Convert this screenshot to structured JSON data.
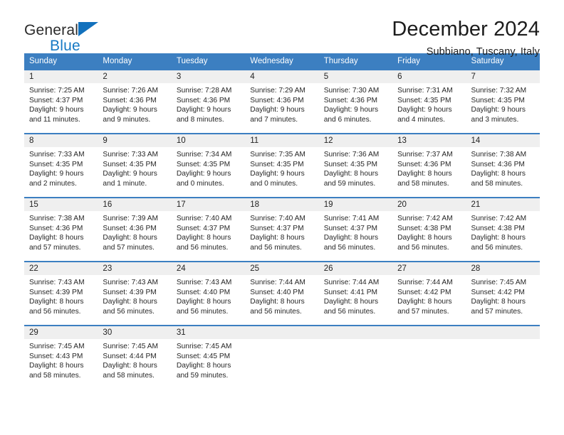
{
  "brand": {
    "line1": "General",
    "line2": "Blue",
    "triangle_color": "#1271bd",
    "line2_color": "#1679c4"
  },
  "header": {
    "title": "December 2024",
    "subtitle": "Subbiano, Tuscany, Italy"
  },
  "theme": {
    "header_blue": "#3c7fc1",
    "datenum_gray": "#efefef",
    "text": "#262626"
  },
  "weekdays": [
    "Sunday",
    "Monday",
    "Tuesday",
    "Wednesday",
    "Thursday",
    "Friday",
    "Saturday"
  ],
  "weeks": [
    [
      {
        "day": "1",
        "sunrise": "Sunrise: 7:25 AM",
        "sunset": "Sunset: 4:37 PM",
        "daylight1": "Daylight: 9 hours",
        "daylight2": "and 11 minutes."
      },
      {
        "day": "2",
        "sunrise": "Sunrise: 7:26 AM",
        "sunset": "Sunset: 4:36 PM",
        "daylight1": "Daylight: 9 hours",
        "daylight2": "and 9 minutes."
      },
      {
        "day": "3",
        "sunrise": "Sunrise: 7:28 AM",
        "sunset": "Sunset: 4:36 PM",
        "daylight1": "Daylight: 9 hours",
        "daylight2": "and 8 minutes."
      },
      {
        "day": "4",
        "sunrise": "Sunrise: 7:29 AM",
        "sunset": "Sunset: 4:36 PM",
        "daylight1": "Daylight: 9 hours",
        "daylight2": "and 7 minutes."
      },
      {
        "day": "5",
        "sunrise": "Sunrise: 7:30 AM",
        "sunset": "Sunset: 4:36 PM",
        "daylight1": "Daylight: 9 hours",
        "daylight2": "and 6 minutes."
      },
      {
        "day": "6",
        "sunrise": "Sunrise: 7:31 AM",
        "sunset": "Sunset: 4:35 PM",
        "daylight1": "Daylight: 9 hours",
        "daylight2": "and 4 minutes."
      },
      {
        "day": "7",
        "sunrise": "Sunrise: 7:32 AM",
        "sunset": "Sunset: 4:35 PM",
        "daylight1": "Daylight: 9 hours",
        "daylight2": "and 3 minutes."
      }
    ],
    [
      {
        "day": "8",
        "sunrise": "Sunrise: 7:33 AM",
        "sunset": "Sunset: 4:35 PM",
        "daylight1": "Daylight: 9 hours",
        "daylight2": "and 2 minutes."
      },
      {
        "day": "9",
        "sunrise": "Sunrise: 7:33 AM",
        "sunset": "Sunset: 4:35 PM",
        "daylight1": "Daylight: 9 hours",
        "daylight2": "and 1 minute."
      },
      {
        "day": "10",
        "sunrise": "Sunrise: 7:34 AM",
        "sunset": "Sunset: 4:35 PM",
        "daylight1": "Daylight: 9 hours",
        "daylight2": "and 0 minutes."
      },
      {
        "day": "11",
        "sunrise": "Sunrise: 7:35 AM",
        "sunset": "Sunset: 4:35 PM",
        "daylight1": "Daylight: 9 hours",
        "daylight2": "and 0 minutes."
      },
      {
        "day": "12",
        "sunrise": "Sunrise: 7:36 AM",
        "sunset": "Sunset: 4:35 PM",
        "daylight1": "Daylight: 8 hours",
        "daylight2": "and 59 minutes."
      },
      {
        "day": "13",
        "sunrise": "Sunrise: 7:37 AM",
        "sunset": "Sunset: 4:36 PM",
        "daylight1": "Daylight: 8 hours",
        "daylight2": "and 58 minutes."
      },
      {
        "day": "14",
        "sunrise": "Sunrise: 7:38 AM",
        "sunset": "Sunset: 4:36 PM",
        "daylight1": "Daylight: 8 hours",
        "daylight2": "and 58 minutes."
      }
    ],
    [
      {
        "day": "15",
        "sunrise": "Sunrise: 7:38 AM",
        "sunset": "Sunset: 4:36 PM",
        "daylight1": "Daylight: 8 hours",
        "daylight2": "and 57 minutes."
      },
      {
        "day": "16",
        "sunrise": "Sunrise: 7:39 AM",
        "sunset": "Sunset: 4:36 PM",
        "daylight1": "Daylight: 8 hours",
        "daylight2": "and 57 minutes."
      },
      {
        "day": "17",
        "sunrise": "Sunrise: 7:40 AM",
        "sunset": "Sunset: 4:37 PM",
        "daylight1": "Daylight: 8 hours",
        "daylight2": "and 56 minutes."
      },
      {
        "day": "18",
        "sunrise": "Sunrise: 7:40 AM",
        "sunset": "Sunset: 4:37 PM",
        "daylight1": "Daylight: 8 hours",
        "daylight2": "and 56 minutes."
      },
      {
        "day": "19",
        "sunrise": "Sunrise: 7:41 AM",
        "sunset": "Sunset: 4:37 PM",
        "daylight1": "Daylight: 8 hours",
        "daylight2": "and 56 minutes."
      },
      {
        "day": "20",
        "sunrise": "Sunrise: 7:42 AM",
        "sunset": "Sunset: 4:38 PM",
        "daylight1": "Daylight: 8 hours",
        "daylight2": "and 56 minutes."
      },
      {
        "day": "21",
        "sunrise": "Sunrise: 7:42 AM",
        "sunset": "Sunset: 4:38 PM",
        "daylight1": "Daylight: 8 hours",
        "daylight2": "and 56 minutes."
      }
    ],
    [
      {
        "day": "22",
        "sunrise": "Sunrise: 7:43 AM",
        "sunset": "Sunset: 4:39 PM",
        "daylight1": "Daylight: 8 hours",
        "daylight2": "and 56 minutes."
      },
      {
        "day": "23",
        "sunrise": "Sunrise: 7:43 AM",
        "sunset": "Sunset: 4:39 PM",
        "daylight1": "Daylight: 8 hours",
        "daylight2": "and 56 minutes."
      },
      {
        "day": "24",
        "sunrise": "Sunrise: 7:43 AM",
        "sunset": "Sunset: 4:40 PM",
        "daylight1": "Daylight: 8 hours",
        "daylight2": "and 56 minutes."
      },
      {
        "day": "25",
        "sunrise": "Sunrise: 7:44 AM",
        "sunset": "Sunset: 4:40 PM",
        "daylight1": "Daylight: 8 hours",
        "daylight2": "and 56 minutes."
      },
      {
        "day": "26",
        "sunrise": "Sunrise: 7:44 AM",
        "sunset": "Sunset: 4:41 PM",
        "daylight1": "Daylight: 8 hours",
        "daylight2": "and 56 minutes."
      },
      {
        "day": "27",
        "sunrise": "Sunrise: 7:44 AM",
        "sunset": "Sunset: 4:42 PM",
        "daylight1": "Daylight: 8 hours",
        "daylight2": "and 57 minutes."
      },
      {
        "day": "28",
        "sunrise": "Sunrise: 7:45 AM",
        "sunset": "Sunset: 4:42 PM",
        "daylight1": "Daylight: 8 hours",
        "daylight2": "and 57 minutes."
      }
    ],
    [
      {
        "day": "29",
        "sunrise": "Sunrise: 7:45 AM",
        "sunset": "Sunset: 4:43 PM",
        "daylight1": "Daylight: 8 hours",
        "daylight2": "and 58 minutes."
      },
      {
        "day": "30",
        "sunrise": "Sunrise: 7:45 AM",
        "sunset": "Sunset: 4:44 PM",
        "daylight1": "Daylight: 8 hours",
        "daylight2": "and 58 minutes."
      },
      {
        "day": "31",
        "sunrise": "Sunrise: 7:45 AM",
        "sunset": "Sunset: 4:45 PM",
        "daylight1": "Daylight: 8 hours",
        "daylight2": "and 59 minutes."
      },
      {
        "day": "",
        "sunrise": "",
        "sunset": "",
        "daylight1": "",
        "daylight2": ""
      },
      {
        "day": "",
        "sunrise": "",
        "sunset": "",
        "daylight1": "",
        "daylight2": ""
      },
      {
        "day": "",
        "sunrise": "",
        "sunset": "",
        "daylight1": "",
        "daylight2": ""
      },
      {
        "day": "",
        "sunrise": "",
        "sunset": "",
        "daylight1": "",
        "daylight2": ""
      }
    ]
  ]
}
